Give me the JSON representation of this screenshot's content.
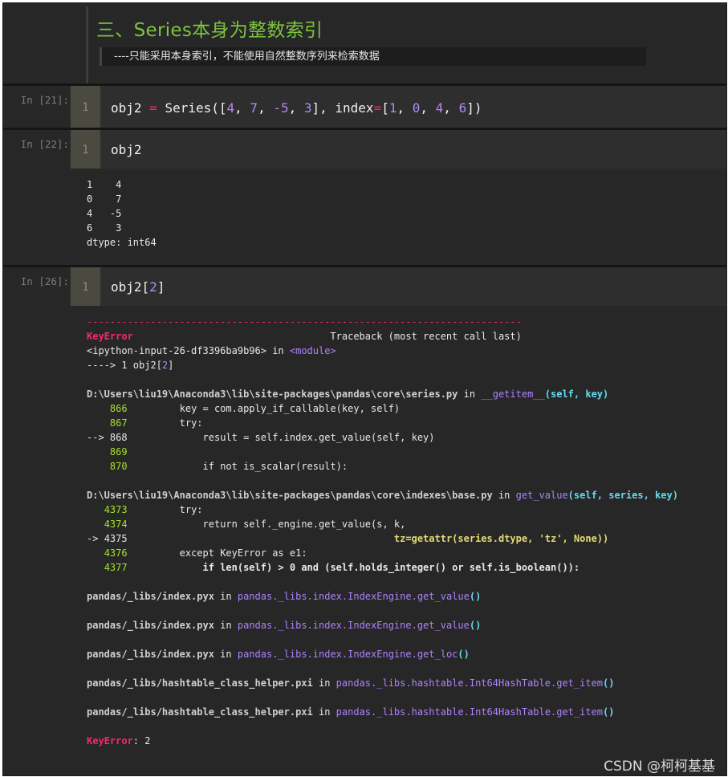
{
  "markdown": {
    "title": "三、Series本身为整数索引",
    "note": "----只能采用本身索引，不能使用自然整数序列来检索数据"
  },
  "cells": [
    {
      "prompt": "In [21]:",
      "line_no": "1",
      "code": {
        "a": "obj2 ",
        "b": "=",
        "c": " Series([",
        "d": "4",
        "e": ", ",
        "f": "7",
        "g": ", ",
        "h": "-5",
        "i": ", ",
        "j": "3",
        "k": "], index",
        "l": "=",
        "m": "[",
        "n": "1",
        "o": ", ",
        "p": "0",
        "q": ", ",
        "r": "4",
        "s": ", ",
        "t": "6",
        "u": "])"
      }
    },
    {
      "prompt": "In [22]:",
      "line_no": "1",
      "code": "obj2"
    },
    {
      "prompt": "In [26]:",
      "line_no": "1",
      "code": {
        "a": "obj2[",
        "b": "2",
        "c": "]"
      }
    }
  ],
  "output22": [
    "1    4",
    "0    7",
    "4   -5",
    "6    3",
    "dtype: int64"
  ],
  "traceback": {
    "dashes": "---------------------------------------------------------------------------",
    "error_name": "KeyError",
    "header_right": "                                  Traceback (most recent call last)",
    "input_line": {
      "a": "<ipython-input-26-df3396ba9b96>",
      "b": " in ",
      "c": "<module>"
    },
    "arrow_line": {
      "a": "----> 1 obj2[",
      "b": "2",
      "c": "]"
    },
    "frame1": {
      "file": "D:\\Users\\liu19\\Anaconda3\\lib\\site-packages\\pandas\\core\\series.py",
      "in": " in ",
      "func": "__getitem__",
      "args": "(self, key)",
      "lines": [
        {
          "prefix": "    ",
          "no": "866",
          "code": "         key = com.apply_if_callable(key, self)"
        },
        {
          "prefix": "    ",
          "no": "867",
          "code": "         try:"
        },
        {
          "prefix": "--> ",
          "no": "868",
          "code": "             result = self.index.get_value(self, key)"
        },
        {
          "prefix": "    ",
          "no": "869",
          "code": ""
        },
        {
          "prefix": "    ",
          "no": "870",
          "code": "             if not is_scalar(result):"
        }
      ]
    },
    "frame2": {
      "file": "D:\\Users\\liu19\\Anaconda3\\lib\\site-packages\\pandas\\core\\indexes\\base.py",
      "in": " in ",
      "func": "get_value",
      "args": "(self, series, key)",
      "lines": [
        {
          "prefix": "   ",
          "no": "4373",
          "code": "         try:"
        },
        {
          "prefix": "   ",
          "no": "4374",
          "code": "             return self._engine.get_value(s, k,"
        },
        {
          "prefix": "-> ",
          "no": "4375",
          "code": "                                              tz=getattr(series.dtype, 'tz', None))"
        },
        {
          "prefix": "   ",
          "no": "4376",
          "code": "         except KeyError as e1:"
        },
        {
          "prefix": "   ",
          "no": "4377",
          "code": "             if len(self) > 0 and (self.holds_integer() or self.is_boolean()):"
        }
      ]
    },
    "frames_short": [
      {
        "file": "pandas/_libs/index.pyx",
        "in": " in ",
        "func": "pandas._libs.index.IndexEngine.get_value",
        "parens": "()"
      },
      {
        "file": "pandas/_libs/index.pyx",
        "in": " in ",
        "func": "pandas._libs.index.IndexEngine.get_value",
        "parens": "()"
      },
      {
        "file": "pandas/_libs/index.pyx",
        "in": " in ",
        "func": "pandas._libs.index.IndexEngine.get_loc",
        "parens": "()"
      },
      {
        "file": "pandas/_libs/hashtable_class_helper.pxi",
        "in": " in ",
        "func": "pandas._libs.hashtable.Int64HashTable.get_item",
        "parens": "()"
      },
      {
        "file": "pandas/_libs/hashtable_class_helper.pxi",
        "in": " in ",
        "func": "pandas._libs.hashtable.Int64HashTable.get_item",
        "parens": "()"
      }
    ],
    "final": {
      "name": "KeyError",
      "msg": ": 2"
    }
  },
  "watermark": "CSDN @柯柯基基",
  "colors": {
    "title_green": "#7cc341",
    "error_red": "#f92672",
    "lineno_green": "#a6e22e",
    "func_violet": "#ae81ff",
    "cyan": "#66d9ef"
  }
}
